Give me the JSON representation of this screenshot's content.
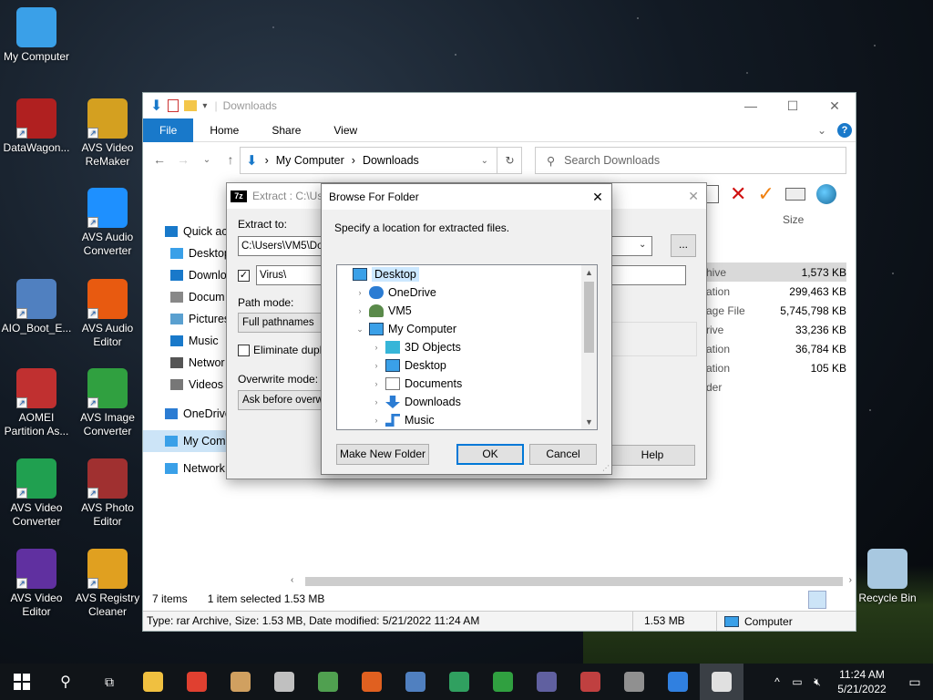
{
  "desktop": {
    "icons": [
      {
        "label": "My Computer",
        "color": "#3aa0e8"
      },
      {
        "label": "DataWagon...",
        "color": "#b02020"
      },
      {
        "label": "AVS Video ReMaker",
        "color": "#d4a020"
      },
      {
        "label": "AVS Audio Converter",
        "color": "#1e90ff"
      },
      {
        "label": "AIO_Boot_E...",
        "color": "#5080c0"
      },
      {
        "label": "AVS Audio Editor",
        "color": "#e85a10"
      },
      {
        "label": "AOMEI Partition As...",
        "color": "#c03030"
      },
      {
        "label": "AVS Image Converter",
        "color": "#30a040"
      },
      {
        "label": "AVS Video Converter",
        "color": "#20a050"
      },
      {
        "label": "AVS Photo Editor",
        "color": "#a03030"
      },
      {
        "label": "AVS Video Editor",
        "color": "#6030a0"
      },
      {
        "label": "AVS Registry Cleaner",
        "color": "#e0a020"
      },
      {
        "label": "Recycle Bin",
        "color": "#a8c8e0"
      }
    ]
  },
  "explorer": {
    "title": "Downloads",
    "ribbon_tabs": [
      "File",
      "Home",
      "Share",
      "View"
    ],
    "address": {
      "root": "My Computer",
      "sep": "›",
      "current": "Downloads"
    },
    "search_placeholder": "Search Downloads",
    "nav_items": [
      "Quick ac",
      "Desktop",
      "Downlo",
      "Docum",
      "Pictures",
      "Music",
      "Networ",
      "Videos",
      "OneDrive",
      "My Com",
      "Network"
    ],
    "column_size": "Size",
    "rows": [
      {
        "type": "hive",
        "size": "1,573 KB",
        "selected": true
      },
      {
        "type": "ation",
        "size": "299,463 KB"
      },
      {
        "type": "age File",
        "size": "5,745,798 KB"
      },
      {
        "type": "rive",
        "size": "33,236 KB"
      },
      {
        "type": "ation",
        "size": "36,784 KB"
      },
      {
        "type": "ation",
        "size": "105 KB"
      },
      {
        "type": "der",
        "size": ""
      }
    ],
    "status": {
      "items": "7 items",
      "selected": "1 item selected  1.53 MB"
    },
    "bottom": {
      "info": "Type: rar Archive, Size: 1.53 MB, Date modified: 5/21/2022 11:24 AM",
      "size": "1.53 MB",
      "location": "Computer"
    }
  },
  "extract_dialog": {
    "title": "Extract : C:\\Use",
    "extract_to_label": "Extract to:",
    "extract_to_value": "C:\\Users\\VM5\\Dow",
    "browse_btn": "...",
    "subfolder_value": "Virus\\",
    "path_mode_label": "Path mode:",
    "path_mode_value": "Full pathnames",
    "eliminate_label": "Eliminate duplica",
    "overwrite_label": "Overwrite mode:",
    "overwrite_value": "Ask before overwri",
    "help_btn": "Help"
  },
  "browse_dialog": {
    "title": "Browse For Folder",
    "close": "✕",
    "instruction": "Specify a location for extracted files.",
    "tree": [
      {
        "label": "Desktop",
        "level": 0,
        "exp": "",
        "icon": "desktop",
        "selected": true
      },
      {
        "label": "OneDrive",
        "level": 1,
        "exp": "›",
        "icon": "cloud"
      },
      {
        "label": "VM5",
        "level": 1,
        "exp": "›",
        "icon": "user"
      },
      {
        "label": "My Computer",
        "level": 1,
        "exp": "⌄",
        "icon": "computer"
      },
      {
        "label": "3D Objects",
        "level": 2,
        "exp": "›",
        "icon": "cube"
      },
      {
        "label": "Desktop",
        "level": 2,
        "exp": "›",
        "icon": "desktop"
      },
      {
        "label": "Documents",
        "level": 2,
        "exp": "›",
        "icon": "doc"
      },
      {
        "label": "Downloads",
        "level": 2,
        "exp": "›",
        "icon": "download"
      },
      {
        "label": "Music",
        "level": 2,
        "exp": "›",
        "icon": "music"
      }
    ],
    "new_folder_btn": "Make New Folder",
    "ok_btn": "OK",
    "cancel_btn": "Cancel"
  },
  "taskbar": {
    "time": "11:24 AM",
    "date": "5/21/2022",
    "apps": [
      "#f0c040",
      "#e04030",
      "#d0a060",
      "#c0c0c0",
      "#50a050",
      "#e06020",
      "#5080c0",
      "#30a060",
      "#30a040",
      "#6060a0",
      "#c04040",
      "#909090",
      "#3080e0",
      "#e0e0e0"
    ]
  }
}
